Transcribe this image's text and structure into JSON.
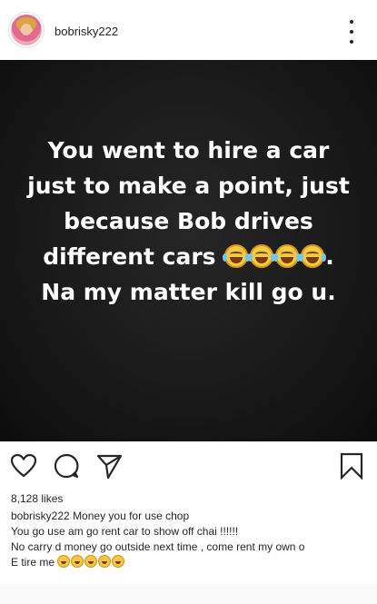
{
  "header": {
    "username": "bobrisky222",
    "avatar": "avatar-image",
    "more_icon": "more-vertical-icon"
  },
  "post": {
    "background": "#161616",
    "text_color": "#ffffff",
    "lines": [
      "You went to hire a car",
      "just to make a point, just",
      "because Bob drives",
      "different cars",
      "Na my matter kill go u."
    ],
    "line4_suffix": ".",
    "emoji_count_in_image": 4
  },
  "actions": {
    "like_icon": "heart-icon",
    "comment_icon": "comment-icon",
    "share_icon": "paper-plane-icon",
    "save_icon": "bookmark-icon"
  },
  "likes": "8,128 likes",
  "caption": {
    "username": "bobrisky222",
    "line1_text": "Money you for use chop",
    "line2": "You go use am go rent car to show off chai !!!!!!",
    "line3": "No carry d money go outside next time , come rent my own o",
    "line4_text": "E tire me",
    "line4_emoji_count": 5
  }
}
